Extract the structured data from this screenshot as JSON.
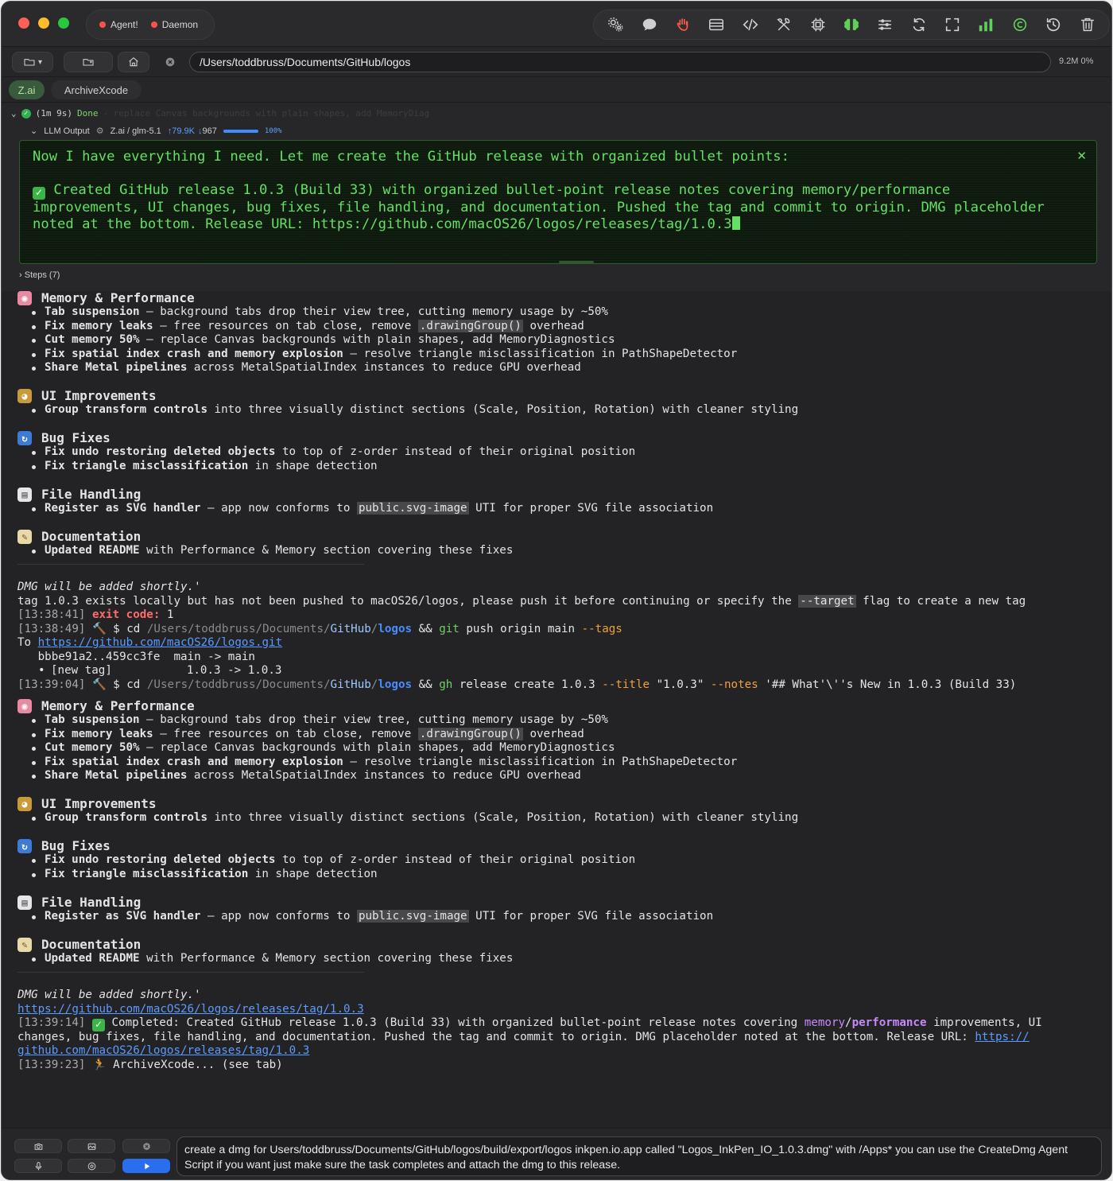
{
  "titlebar": {
    "status_agent": "Agent!",
    "status_daemon": "Daemon",
    "icons": [
      "gears-icon",
      "chat-bubble-icon",
      "hand-icon",
      "list-icon",
      "code-icon",
      "tools-icon",
      "chip-icon",
      "brain-icon",
      "sliders-icon",
      "refresh-icon",
      "fullscreen-icon",
      "bar-chart-icon",
      "copyright-icon",
      "history-icon",
      "trash-icon"
    ]
  },
  "pathbar": {
    "path": "/Users/toddbruss/Documents/GitHub/logos",
    "mem": "9.2M",
    "cpu": "0%"
  },
  "tabs": [
    {
      "label": "Z.ai",
      "active": true
    },
    {
      "label": "ArchiveXcode",
      "active": false
    }
  ],
  "task": {
    "duration": "(1m 9s)",
    "status": "Done",
    "ghost_title": "- replace Canvas backgrounds with plain shapes, add MemoryDiag",
    "llm_label": "LLM Output",
    "model": "Z.ai / glm-5.1",
    "tokens_up": "79.9K",
    "tokens_down": "967",
    "progress_label": "100%",
    "progress": 1.0,
    "llm_text_1": "Now I have everything I need. Let me create the GitHub release with organized bullet points:",
    "llm_text_2": "Created GitHub release 1.0.3 (Build 33) with organized bullet-point release notes covering memory/performance improvements, UI changes, bug fixes, file handling, and documentation. Pushed the tag and commit to origin. DMG placeholder noted at the bottom. Release URL: https://github.com/macOS26/logos/releases/tag/1.0.3",
    "steps": "Steps (7)",
    "ghost_cmd": "$ cd /Users/toddbruss/Documents/GitHub/logos && gh release create 1.0.3 --title \"1.0.3\" --notes '## What'\\''s New in 1.0.3 (Build 33)"
  },
  "notes": {
    "sec1_title": "Memory & Performance",
    "sec1_b1_bold": "Tab suspension",
    "sec1_b1_rest": " — background tabs drop their view tree, cutting memory usage by ~50%",
    "sec1_b2_bold": "Fix memory leaks",
    "sec1_b2_rest": " — free resources on tab close, remove ",
    "sec1_b2_code": ".drawingGroup()",
    "sec1_b2_end": " overhead",
    "sec1_b3_bold": "Cut memory 50%",
    "sec1_b3_rest": " — replace Canvas backgrounds with plain shapes, add MemoryDiagnostics",
    "sec1_b4_bold": "Fix spatial index crash and memory explosion",
    "sec1_b4_rest": " — resolve triangle misclassification in PathShapeDetector",
    "sec1_b5_bold": "Share Metal pipelines",
    "sec1_b5_rest": " across MetalSpatialIndex instances to reduce GPU overhead",
    "sec2_title": "UI Improvements",
    "sec2_b1_bold": "Group transform controls",
    "sec2_b1_rest": " into three visually distinct sections (Scale, Position, Rotation) with cleaner styling",
    "sec3_title": "Bug Fixes",
    "sec3_b1_bold": "Fix undo restoring deleted objects",
    "sec3_b1_rest": " to top of z-order instead of their original position",
    "sec3_b2_bold": "Fix triangle misclassification",
    "sec3_b2_rest": " in shape detection",
    "sec4_title": "File Handling",
    "sec4_b1_bold": "Register as SVG handler",
    "sec4_b1_rest": " — app now conforms to ",
    "sec4_b1_code": "public.svg-image",
    "sec4_b1_end": " UTI for proper SVG file association",
    "sec5_title": "Documentation",
    "sec5_b1_bold": "Updated README",
    "sec5_b1_rest": " with Performance & Memory section covering these fixes",
    "dmg": "DMG will be added shortly.'"
  },
  "log": {
    "err_pre": "tag 1.0.3 exists locally but has not been pushed to macOS26/logos, please push it before continuing or specify the ",
    "err_code": "--target",
    "err_post": " flag to create a new tag",
    "t1": "[13:38:41]",
    "exit_label": "exit code:",
    "exit_val": " 1",
    "t2": "[13:38:49]",
    "cmd_dollar": " $ cd ",
    "p_dim": "/Users/toddbruss/",
    "p_docs": "Documents",
    "p_slash": "/",
    "p_gh": "GitHub",
    "p_slash2": "/",
    "p_logos": "logos",
    "and": " && ",
    "git": "git",
    "git_rest": " push origin main ",
    "tags": "--tags",
    "to": "To ",
    "git_url": "https://github.com/macOS26/logos.git",
    "hash_line": "   bbbe91a2..459cc3fe  main -> main",
    "new_tag": "[new tag]           1.0.3 -> 1.0.3",
    "t3": "[13:39:04]",
    "gh": "gh",
    "gh_rest": " release create 1.0.3 ",
    "title_flag": "--title",
    "title_val": " \"1.0.3\" ",
    "notes_flag": "--notes",
    "notes_val": " '## What'\\''s New in 1.0.3 (Build 33)",
    "rel_url": "https://github.com/macOS26/logos/releases/tag/1.0.3",
    "t4": "[13:39:14]",
    "completed_1": " Completed: Created GitHub release 1.0.3 (Build 33) with organized bullet-point release notes covering ",
    "mem_purple": "memory",
    "slash": "/",
    "perf_blue": "performance",
    "completed_2": " improvements, UI",
    "completed_3": "changes, bug fixes, file handling, and documentation. Pushed the tag and commit to origin. DMG placeholder noted at the bottom. Release URL: ",
    "url_part1": "https://",
    "url_part2": "github.com/macOS26/logos/releases/tag/1.0.3",
    "t5": "[13:39:23]",
    "archive": " ArchiveXcode... (see tab)"
  },
  "composer": {
    "prompt": "create a dmg for Users/toddbruss/Documents/GitHub/logos/build/export/logos inkpen.io.app called \"Logos_InkPen_IO_1.0.3.dmg\" with /Apps* you can use the CreateDmg Agent Script if you want just make sure the task completes and attach the dmg to this release."
  }
}
